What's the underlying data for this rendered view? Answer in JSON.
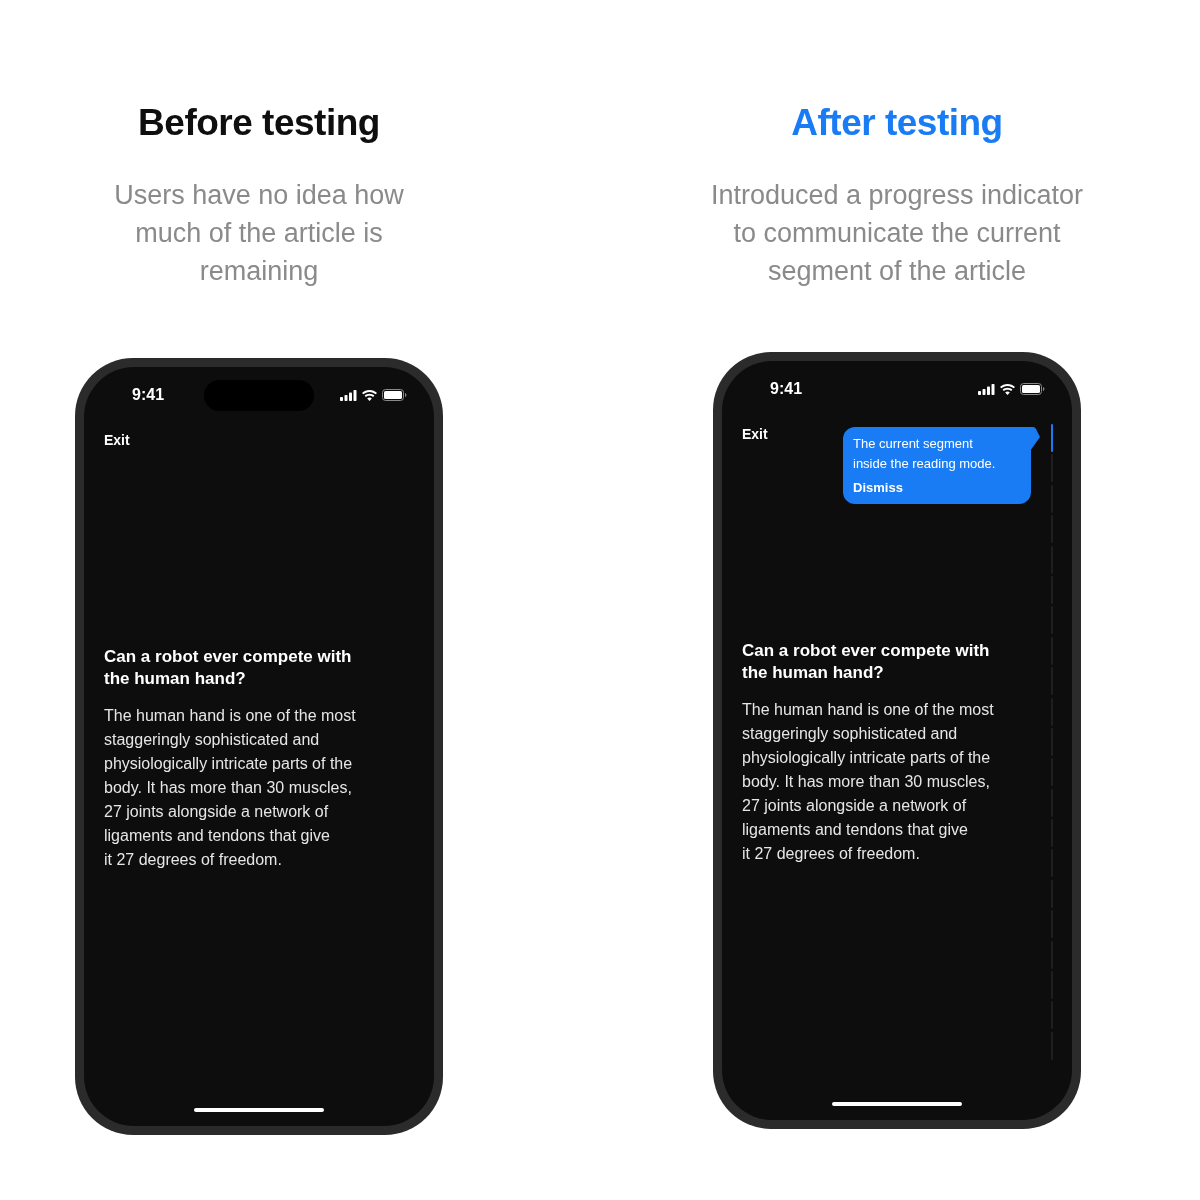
{
  "panels": [
    {
      "heading": "Before testing",
      "highlighted": false,
      "description": "Users have no idea how\nmuch of the article is\nremaining",
      "phone": {
        "status_bar": {
          "time": "9:41"
        },
        "dynamic_island": true,
        "exit": "Exit",
        "article": {
          "title": "Can a robot ever compete with\nthe human hand?",
          "body": "The human hand is one of the most\nstaggeringly sophisticated and\nphysiologically intricate parts of the\nbody. It has more than 30 muscles,\n27 joints alongside a network of\nligaments and tendons that give\nit 27 degrees of freedom."
        }
      }
    },
    {
      "heading": "After testing",
      "highlighted": true,
      "description": "Introduced a progress indicator\nto communicate the current\nsegment of the article",
      "phone": {
        "status_bar": {
          "time": "9:41"
        },
        "dynamic_island": false,
        "exit": "Exit",
        "tooltip": {
          "text": "The current segment\ninside the reading mode.",
          "action": "Dismiss"
        },
        "progress_segments": [
          {
            "current": true
          },
          {
            "current": false
          },
          {
            "current": false
          },
          {
            "current": false
          },
          {
            "current": false
          },
          {
            "current": false
          },
          {
            "current": false
          },
          {
            "current": false
          },
          {
            "current": false
          },
          {
            "current": false
          },
          {
            "current": false
          },
          {
            "current": false
          },
          {
            "current": false
          },
          {
            "current": false
          },
          {
            "current": false
          },
          {
            "current": false
          },
          {
            "current": false
          },
          {
            "current": false
          },
          {
            "current": false
          },
          {
            "current": false
          },
          {
            "current": false
          }
        ],
        "article": {
          "title": "Can a robot ever compete with\nthe human hand?",
          "body": "The human hand is one of the most\nstaggeringly sophisticated and\nphysiologically intricate parts of the\nbody. It has more than 30 muscles,\n27 joints alongside a network of\nligaments and tendons that give\nit 27 degrees of freedom."
        }
      }
    }
  ]
}
